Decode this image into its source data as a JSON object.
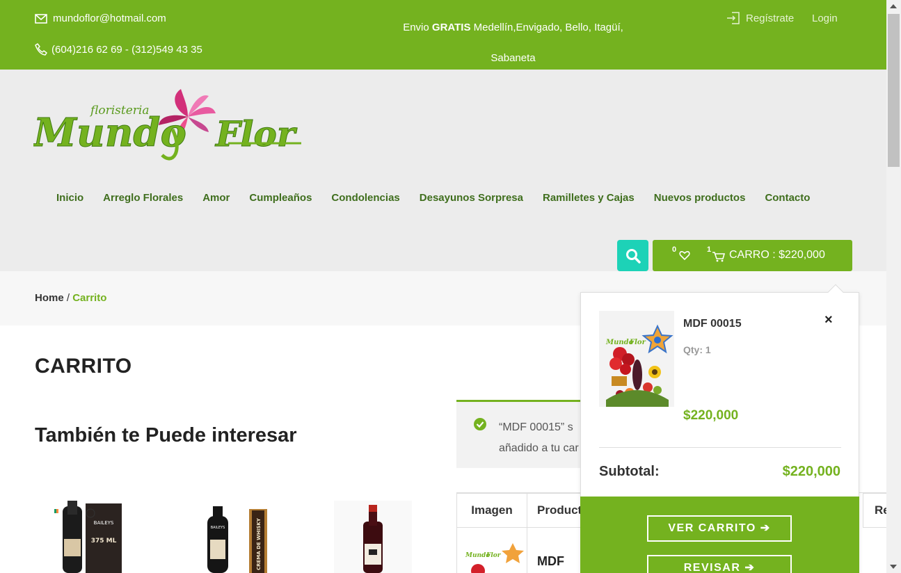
{
  "topbar": {
    "email": "mundoflor@hotmail.com",
    "phone": "(604)216 62 69 - (312)549 43 35",
    "shipping_prefix": "Envio",
    "shipping_bold": "GRATIS",
    "shipping_line1": "Medellín,Envigado, Bello, Itagüí,",
    "shipping_line2": "Sabaneta",
    "register": "Regístrate",
    "login": "Login"
  },
  "logo": {
    "small": "floristeria",
    "main": "Mundo Flor"
  },
  "nav": [
    "Inicio",
    "Arreglo Florales",
    "Amor",
    "Cumpleaños",
    "Condolencias",
    "Desayunos Sorpresa",
    "Ramilletes y Cajas",
    "Nuevos productos",
    "Contacto"
  ],
  "cart_button": {
    "wishlist_count": "0",
    "cart_count": "1",
    "label": "CARRO : $220,000"
  },
  "breadcrumb": {
    "home": "Home",
    "sep": " / ",
    "current": "Carrito"
  },
  "page_title": "CARRITO",
  "also_title": "También te Puede interesar",
  "related_products": [
    {
      "label": "375 ML",
      "brand": "BAILEYS"
    },
    {
      "label": "CREMA DE WHISKY",
      "brand": "BAILEYS"
    },
    {
      "label": "",
      "brand": ""
    }
  ],
  "notice": {
    "line1": "“MDF 00015” s",
    "line2": "añadido a tu car"
  },
  "cart_table": {
    "col_image": "Imagen",
    "col_product": "Product",
    "col_last": "Re",
    "row_product": "MDF"
  },
  "mini_cart": {
    "product_name": "MDF 00015",
    "qty": "Qty: 1",
    "price": "$220,000",
    "subtotal_label": "Subtotal:",
    "subtotal_value": "$220,000",
    "view_cart": "VER CARRITO ➔",
    "checkout": "REVISAR ➔",
    "close": "×"
  },
  "colors": {
    "brand_green": "#74b21f",
    "teal": "#1dd2b7",
    "nav_text": "#3f6e1d"
  }
}
